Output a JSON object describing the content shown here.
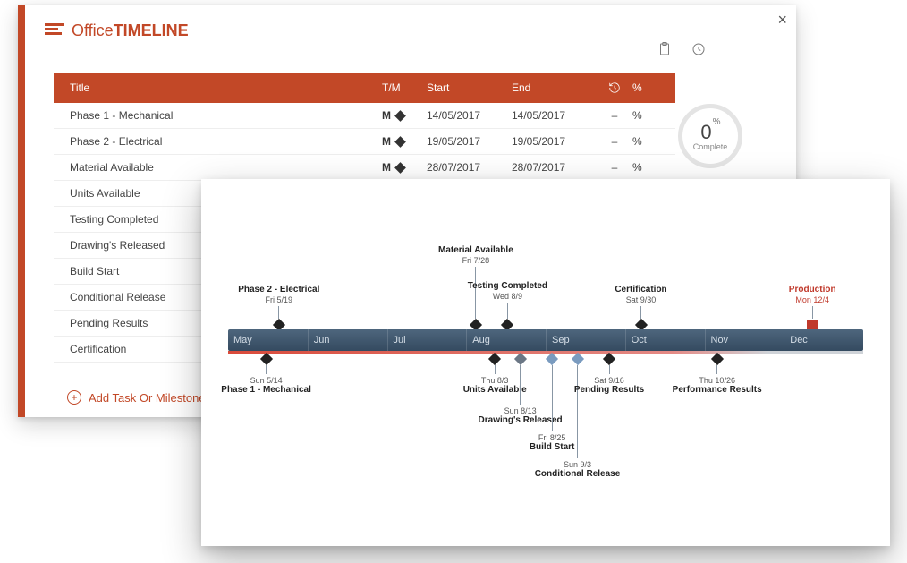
{
  "app": {
    "brand_prefix": "Office",
    "brand_suffix": "TIMELINE"
  },
  "progress": {
    "value": "0",
    "unit": "%",
    "label": "Complete"
  },
  "columns": {
    "title": "Title",
    "tm": "T/M",
    "start": "Start",
    "end": "End",
    "history_icon": "history-icon",
    "percent": "%"
  },
  "rows": [
    {
      "title": "Phase 1 - Mechanical",
      "tm": "M",
      "start": "14/05/2017",
      "end": "14/05/2017",
      "dur": "–",
      "pct": "%"
    },
    {
      "title": "Phase 2 - Electrical",
      "tm": "M",
      "start": "19/05/2017",
      "end": "19/05/2017",
      "dur": "–",
      "pct": "%"
    },
    {
      "title": "Material Available",
      "tm": "M",
      "start": "28/07/2017",
      "end": "28/07/2017",
      "dur": "–",
      "pct": "%"
    },
    {
      "title": "Units Available"
    },
    {
      "title": "Testing Completed"
    },
    {
      "title": "Drawing's Released"
    },
    {
      "title": "Build Start"
    },
    {
      "title": "Conditional Release"
    },
    {
      "title": "Pending Results"
    },
    {
      "title": "Certification"
    }
  ],
  "add_label": "Add Task Or Milestone",
  "timeline": {
    "months": [
      "May",
      "Jun",
      "Jul",
      "Aug",
      "Sep",
      "Oct",
      "Nov",
      "Dec"
    ],
    "above": [
      {
        "title": "Phase 2 - Electrical",
        "date": "Fri 5/19",
        "x": 8,
        "stem": 14,
        "cls": ""
      },
      {
        "title": "Material Available",
        "date": "Fri 7/28",
        "x": 39,
        "stem": 58,
        "cls": ""
      },
      {
        "title": "Testing Completed",
        "date": "Wed 8/9",
        "x": 44,
        "stem": 18,
        "cls": ""
      },
      {
        "title": "Certification",
        "date": "Sat 9/30",
        "x": 65,
        "stem": 14,
        "cls": ""
      },
      {
        "title": "Production",
        "date": "Mon 12/4",
        "x": 92,
        "stem": 14,
        "cls": "red"
      }
    ],
    "below": [
      {
        "title": "Phase 1 - Mechanical",
        "date": "Sun 5/14",
        "x": 6,
        "stem": 10,
        "cls": ""
      },
      {
        "title": "Units Available",
        "date": "Thu 8/3",
        "x": 42,
        "stem": 10,
        "cls": ""
      },
      {
        "title": "Drawing's Released",
        "date": "Sun 8/13",
        "x": 46,
        "stem": 44,
        "cls": "grey"
      },
      {
        "title": "Build Start",
        "date": "Fri 8/25",
        "x": 51,
        "stem": 74,
        "cls": "blue"
      },
      {
        "title": "Conditional Release",
        "date": "Sun 9/3",
        "x": 55,
        "stem": 104,
        "cls": "blue"
      },
      {
        "title": "Pending Results",
        "date": "Sat 9/16",
        "x": 60,
        "stem": 10,
        "cls": ""
      },
      {
        "title": "Performance Results",
        "date": "Thu 10/26",
        "x": 77,
        "stem": 10,
        "cls": ""
      }
    ]
  }
}
